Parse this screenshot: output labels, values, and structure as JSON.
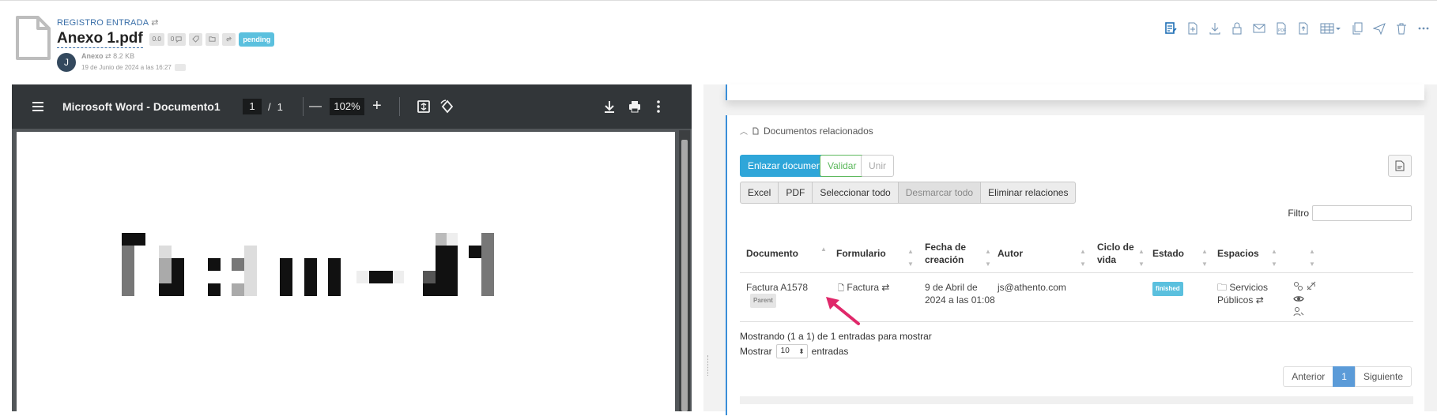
{
  "header": {
    "breadcrumb": "REGISTRO ENTRADA",
    "title": "Anexo 1.pdf",
    "chips": [
      "0.0",
      "0"
    ],
    "status": "pending",
    "avatar_initial": "J",
    "owner": "Anexo",
    "size": "8.2 KB",
    "date": "19 de Junio de 2024 a las 16:27"
  },
  "toolbar": {
    "icons": [
      "edit-document-icon",
      "new-version-icon",
      "download-icon",
      "lock-icon",
      "mail-icon",
      "pdf-icon",
      "export-icon",
      "columns-icon",
      "copy-icon",
      "send-icon",
      "trash-icon",
      "more-icon"
    ]
  },
  "pdf_viewer": {
    "title": "Microsoft Word - Documento1",
    "current_page": "1",
    "separator": "/",
    "total_pages": "1",
    "zoom": "102%",
    "minus": "—",
    "plus": "+"
  },
  "related": {
    "heading": "Documentos relacionados",
    "link_button": "Enlazar documento",
    "validate_button": "Validar",
    "merge_button": "Unir",
    "export_buttons": [
      "Excel",
      "PDF",
      "Seleccionar todo",
      "Desmarcar todo",
      "Eliminar relaciones"
    ],
    "filter_label": "Filtro",
    "columns": [
      "Documento",
      "Formulario",
      "Fecha de creación",
      "Autor",
      "Ciclo de vida",
      "Estado",
      "Espacios"
    ],
    "rows": [
      {
        "documento": "Factura A1578",
        "badge": "Parent",
        "formulario": "Factura",
        "fecha": "9 de Abril de 2024 a las 01:08",
        "autor": "js@athento.com",
        "ciclo": "",
        "estado": "finished",
        "espacios": "Servicios Públicos"
      }
    ],
    "info": "Mostrando (1 a 1) de 1 entradas para mostrar",
    "show_label": "Mostrar",
    "page_size": "10",
    "entries_label": "entradas",
    "pager": {
      "prev": "Anterior",
      "current": "1",
      "next": "Siguiente"
    }
  },
  "colors": {
    "accent": "#2fa6d9",
    "success": "#5cb85c",
    "status_info": "#5bc0de",
    "annotation_arrow": "#e0286a"
  }
}
